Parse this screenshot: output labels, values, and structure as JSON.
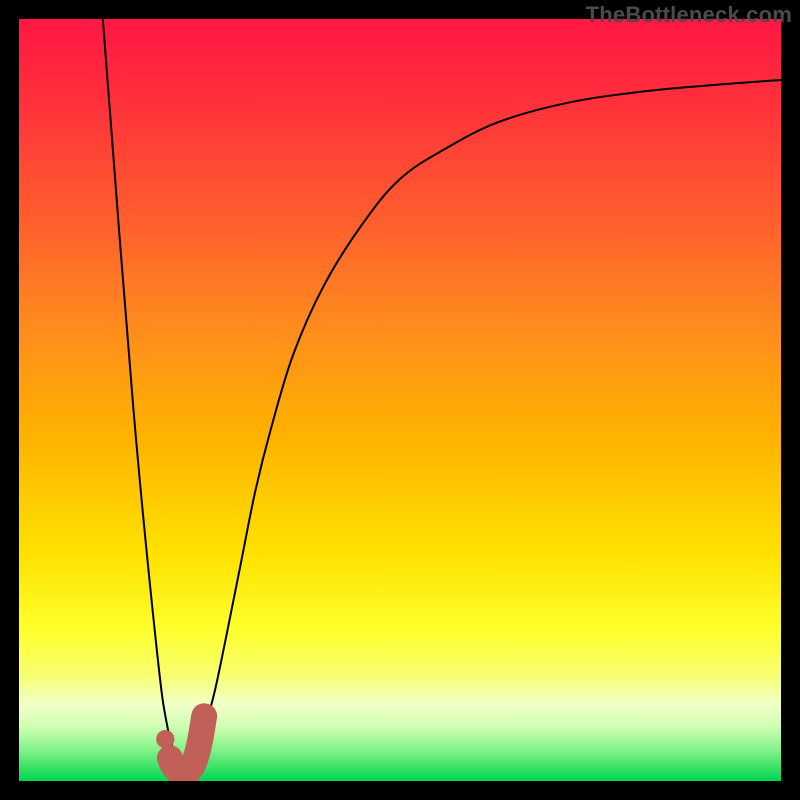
{
  "watermark": "TheBottleneck.com",
  "chart_data": {
    "type": "line",
    "title": "",
    "xlabel": "",
    "ylabel": "",
    "xlim": [
      0,
      100
    ],
    "ylim": [
      0,
      100
    ],
    "grid": false,
    "legend": false,
    "gradient_stops": [
      {
        "offset": 0.0,
        "color": "#ff1744"
      },
      {
        "offset": 0.1,
        "color": "#ff2e3c"
      },
      {
        "offset": 0.25,
        "color": "#ff5a2f"
      },
      {
        "offset": 0.4,
        "color": "#ff8a1e"
      },
      {
        "offset": 0.55,
        "color": "#ffb300"
      },
      {
        "offset": 0.7,
        "color": "#ffe100"
      },
      {
        "offset": 0.8,
        "color": "#ffff2a"
      },
      {
        "offset": 0.86,
        "color": "#f7ff70"
      },
      {
        "offset": 0.9,
        "color": "#f2ffc9"
      },
      {
        "offset": 0.93,
        "color": "#ccffb0"
      },
      {
        "offset": 0.96,
        "color": "#82f28a"
      },
      {
        "offset": 0.985,
        "color": "#30e060"
      },
      {
        "offset": 1.0,
        "color": "#00d657"
      }
    ],
    "series": [
      {
        "name": "curve",
        "stroke": "#000000",
        "stroke_width": 2,
        "x": [
          11,
          15,
          18,
          19.5,
          21,
          22.5,
          24,
          25.5,
          27,
          29,
          31,
          33,
          36,
          40,
          45,
          50,
          56,
          63,
          72,
          82,
          92,
          100
        ],
        "y": [
          100,
          49,
          18,
          7,
          3,
          3.5,
          6,
          11,
          18,
          28,
          38,
          46,
          56,
          65,
          73,
          79,
          83,
          86.5,
          89,
          90.5,
          91.4,
          92
        ]
      }
    ],
    "marker": {
      "color": "#c06058",
      "dot": {
        "x": 19.2,
        "y": 5.5,
        "r": 1.2
      },
      "hook": [
        {
          "x": 19.8,
          "y": 3.0
        },
        {
          "x": 20.4,
          "y": 1.8
        },
        {
          "x": 21.3,
          "y": 1.2
        },
        {
          "x": 22.2,
          "y": 1.3
        },
        {
          "x": 23.0,
          "y": 2.5
        },
        {
          "x": 23.7,
          "y": 5.0
        },
        {
          "x": 24.3,
          "y": 8.5
        }
      ],
      "stroke_width": 3.4
    }
  }
}
